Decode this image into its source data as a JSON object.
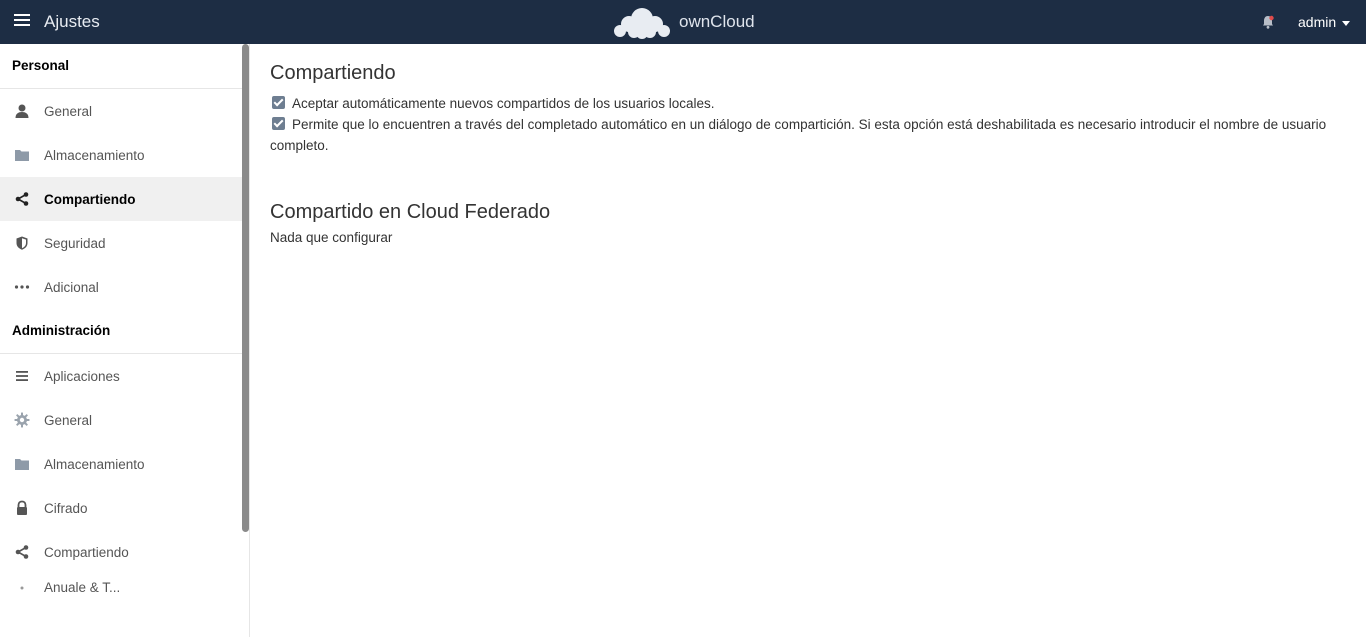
{
  "header": {
    "title": "Ajustes",
    "brand": "ownCloud",
    "user": "admin",
    "menu_icon": "hamburger-icon",
    "notification_icon": "bell-icon",
    "background": "#1d2d44"
  },
  "sidebar": {
    "personal_title": "Personal",
    "personal_items": [
      {
        "label": "General",
        "icon": "user-icon"
      },
      {
        "label": "Almacenamiento",
        "icon": "folder-icon"
      },
      {
        "label": "Compartiendo",
        "icon": "share-icon",
        "active": true
      },
      {
        "label": "Seguridad",
        "icon": "shield-icon"
      },
      {
        "label": "Adicional",
        "icon": "more-icon"
      }
    ],
    "admin_title": "Administración",
    "admin_items": [
      {
        "label": "Aplicaciones",
        "icon": "list-icon"
      },
      {
        "label": "General",
        "icon": "gear-icon"
      },
      {
        "label": "Almacenamiento",
        "icon": "folder-icon"
      },
      {
        "label": "Cifrado",
        "icon": "lock-icon"
      },
      {
        "label": "Compartiendo",
        "icon": "share-icon"
      },
      {
        "label": "Anuale & T...",
        "icon": "item-icon"
      }
    ]
  },
  "main": {
    "sharing_title": "Compartiendo",
    "options": [
      {
        "label": "Aceptar automáticamente nuevos compartidos de los usuarios locales.",
        "checked": true
      },
      {
        "label": "Permite que lo encuentren a través del completado automático en un diálogo de compartición. Si esta opción está deshabilitada es necesario introducir el nombre de usuario completo.",
        "checked": true
      }
    ],
    "federated_title": "Compartido en Cloud Federado",
    "federated_text": "Nada que configurar"
  }
}
